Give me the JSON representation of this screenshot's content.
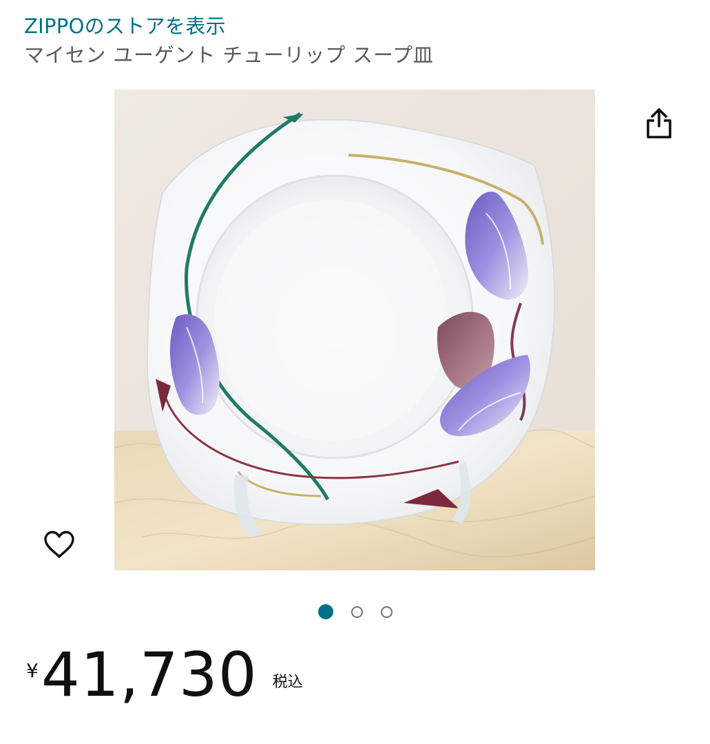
{
  "store": {
    "link_label": "ZIPPOのストアを表示"
  },
  "product": {
    "title": "マイセン ユーゲント チューリップ スープ皿",
    "image_alt": "",
    "image_count": 3,
    "active_image_index": 0
  },
  "price": {
    "currency_symbol": "¥",
    "amount": "41,730",
    "tax_label": "税込"
  },
  "icons": {
    "share": "share-icon",
    "wishlist": "heart-outline-icon"
  },
  "colors": {
    "link": "#007185",
    "title": "#565959",
    "active_dot": "#007185",
    "inactive_dot_border": "#6f7373",
    "price_text": "#0f1111"
  }
}
